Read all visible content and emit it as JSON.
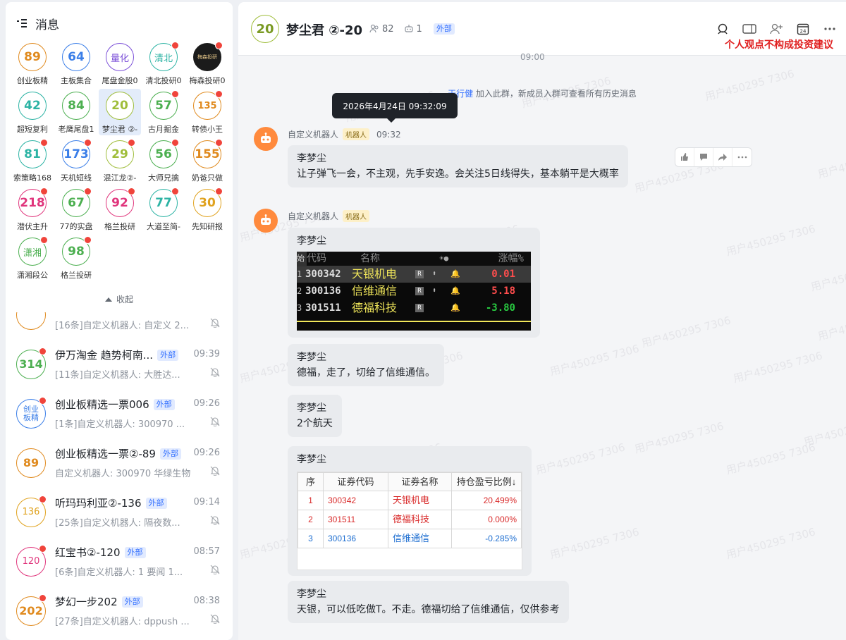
{
  "left_panel": {
    "title": "消息",
    "collapse_label": "收起",
    "grid": [
      {
        "text": "89",
        "label": "创业板精",
        "color": "#e08a1e",
        "dot": false
      },
      {
        "text": "64",
        "label": "主板集合",
        "color": "#3a7ee8",
        "dot": false
      },
      {
        "text": "量化",
        "label": "尾盘金股0",
        "color": "#7b4fd8",
        "dot": false,
        "cn": true
      },
      {
        "text": "清北",
        "label": "清北投研0",
        "color": "#2cb3a4",
        "dot": true,
        "cn": true
      },
      {
        "text": "梅森投研",
        "label": "梅森投研0",
        "color": "#1b1b1b",
        "dot": true,
        "img": true
      },
      {
        "text": "42",
        "label": "超短复利",
        "color": "#2cb3a4",
        "dot": false
      },
      {
        "text": "84",
        "label": "老鹰尾盘1",
        "color": "#4caf50",
        "dot": false
      },
      {
        "text": "20",
        "label": "梦尘君 ②-",
        "color": "#9fbd3a",
        "dot": false,
        "selected": true
      },
      {
        "text": "57",
        "label": "古月掘金",
        "color": "#4caf50",
        "dot": true
      },
      {
        "text": "135",
        "label": "转债小王",
        "color": "#e08a1e",
        "dot": true,
        "small": true
      },
      {
        "text": "81",
        "label": "索策略168",
        "color": "#2cb3a4",
        "dot": true
      },
      {
        "text": "173",
        "label": "天机短线",
        "color": "#3a7ee8",
        "dot": true
      },
      {
        "text": "29",
        "label": "混江龙②-",
        "color": "#9fbd3a",
        "dot": true
      },
      {
        "text": "56",
        "label": "大师兄擒",
        "color": "#4caf50",
        "dot": true
      },
      {
        "text": "155",
        "label": "奶爸只做",
        "color": "#e08a1e",
        "dot": true
      },
      {
        "text": "218",
        "label": "潜伏主升",
        "color": "#e0357c",
        "dot": true
      },
      {
        "text": "67",
        "label": "77的实盘",
        "color": "#4caf50",
        "dot": true
      },
      {
        "text": "92",
        "label": "格兰投研",
        "color": "#e0357c",
        "dot": true
      },
      {
        "text": "77",
        "label": "大道至简-",
        "color": "#2cb3a4",
        "dot": true
      },
      {
        "text": "30",
        "label": "先知研报",
        "color": "#e0a21e",
        "dot": true
      },
      {
        "text": "潇湘",
        "label": "潇湘段公",
        "color": "#4caf50",
        "dot": true,
        "cn": true
      },
      {
        "text": "98",
        "label": "格兰投研",
        "color": "#4caf50",
        "dot": true
      }
    ],
    "conversations": [
      {
        "avatar": "",
        "name": "",
        "tag": "",
        "time": "",
        "preview": "[16条]自定义机器人: 自定义 2...",
        "color": "#e08a1e",
        "dot": false
      },
      {
        "avatar": "314",
        "name": "伊万淘金 趋势柯南...",
        "tag": "外部",
        "time": "09:39",
        "preview": "[11条]自定义机器人: 大胜达...",
        "color": "#4caf50",
        "dot": true
      },
      {
        "avatar": "创业板精",
        "name": "创业板精选一票006",
        "tag": "外部",
        "time": "09:26",
        "preview": "[1条]自定义机器人: 300970 ...",
        "color": "#3a7ee8",
        "dot": true,
        "cn": true
      },
      {
        "avatar": "89",
        "name": "创业板精选一票②-89",
        "tag": "外部",
        "time": "09:26",
        "preview": "自定义机器人: 300970 华绿生物",
        "color": "#e08a1e",
        "dot": false
      },
      {
        "avatar": "136",
        "name": "听玛玛利亚②-136",
        "tag": "外部",
        "time": "09:14",
        "preview": "[25条]自定义机器人: 隔夜数...",
        "color": "#e0a21e",
        "dot": true,
        "small": true
      },
      {
        "avatar": "120",
        "name": "红宝书②-120",
        "tag": "外部",
        "time": "08:57",
        "preview": "[6条]自定义机器人: 1 要闻 1...",
        "color": "#e0357c",
        "dot": true,
        "small": true
      },
      {
        "avatar": "202",
        "name": "梦幻一步202",
        "tag": "外部",
        "time": "08:38",
        "preview": "[27条]自定义机器人: dppush ...",
        "color": "#e08a1e",
        "dot": true
      }
    ]
  },
  "chat": {
    "avatar": "20",
    "title": "梦尘君 ②-20",
    "members": "82",
    "bots": "1",
    "tag": "外部",
    "calendar_day": "24",
    "note": "个人观点不构成投资建议",
    "top_time": "09:00",
    "system": {
      "prefix": "",
      "name": "天行健",
      "text": " 加入此群，新成员入群可查看所有历史消息"
    },
    "tooltip": "2026年4月24日 09:32:09",
    "watermark": "用户450295 7306",
    "sender": "自定义机器人",
    "robot_tag": "机器人",
    "msg1_time": "09:32",
    "msg1_author": "李梦尘",
    "msg1_text": "让子弹飞一会，不主观，先手安逸。会关注5日线得失，基本躺平是大概率",
    "msg2_author": "李梦尘",
    "stock_head": {
      "c0": "始",
      "c1": "代码",
      "c2": "名称",
      "c3": "☀●",
      "c4": "涨幅%"
    },
    "stocks": [
      {
        "idx": "1",
        "code": "300342",
        "name": "天银机电",
        "chg": "0.01",
        "color": "#ff4d4d"
      },
      {
        "idx": "2",
        "code": "300136",
        "name": "信维通信",
        "chg": "5.18",
        "color": "#ff4d4d"
      },
      {
        "idx": "3",
        "code": "301511",
        "name": "德福科技",
        "chg": "-3.80",
        "color": "#28c840"
      }
    ],
    "msg3_author": "李梦尘",
    "msg3_text": "德福，走了，切给了信维通信。",
    "msg4_author": "李梦尘",
    "msg4_text": "2个航天",
    "msg5_author": "李梦尘",
    "table_head": {
      "c0": "序",
      "c1": "证券代码",
      "c2": "证券名称",
      "c3": "持仓盈亏比例↓"
    },
    "holdings": [
      {
        "no": "1",
        "code": "300342",
        "name": "天银机电",
        "ratio": "20.499%",
        "cls": "red"
      },
      {
        "no": "2",
        "code": "301511",
        "name": "德福科技",
        "ratio": "0.000%",
        "cls": "red"
      },
      {
        "no": "3",
        "code": "300136",
        "name": "信维通信",
        "ratio": "-0.285%",
        "cls": "blue"
      }
    ],
    "msg6_author": "李梦尘",
    "msg6_text": "天银，可以低吃做T。不走。德福切给了信维通信，仅供参考"
  }
}
